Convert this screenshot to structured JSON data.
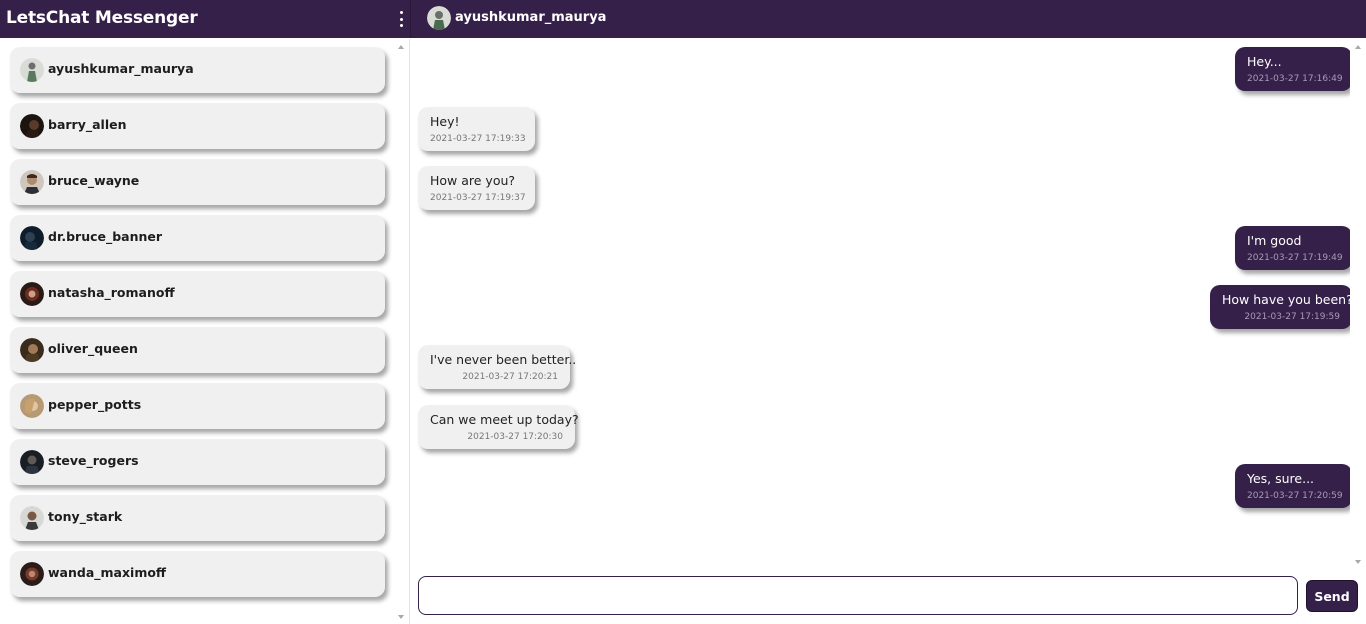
{
  "app": {
    "title": "LetsChat Messenger",
    "menu_icon": "more-vertical-icon",
    "accent_color": "#35204a"
  },
  "header": {
    "contact_name": "ayushkumar_maurya"
  },
  "contacts": [
    {
      "name": "ayushkumar_maurya"
    },
    {
      "name": "barry_allen"
    },
    {
      "name": "bruce_wayne"
    },
    {
      "name": "dr.bruce_banner"
    },
    {
      "name": "natasha_romanoff"
    },
    {
      "name": "oliver_queen"
    },
    {
      "name": "pepper_potts"
    },
    {
      "name": "steve_rogers"
    },
    {
      "name": "tony_stark"
    },
    {
      "name": "wanda_maximoff"
    }
  ],
  "messages": [
    {
      "direction": "out",
      "text": "Hey...",
      "time": "2021-03-27 17:16:49"
    },
    {
      "direction": "in",
      "text": "Hey!",
      "time": "2021-03-27 17:19:33"
    },
    {
      "direction": "in",
      "text": "How are you?",
      "time": "2021-03-27 17:19:37"
    },
    {
      "direction": "out",
      "text": "I'm good",
      "time": "2021-03-27 17:19:49"
    },
    {
      "direction": "out",
      "text": "How have you been?",
      "time": "2021-03-27 17:19:59"
    },
    {
      "direction": "in",
      "text": "I've never been better..",
      "time": "2021-03-27 17:20:21"
    },
    {
      "direction": "in",
      "text": "Can we meet up today?",
      "time": "2021-03-27 17:20:30"
    },
    {
      "direction": "out",
      "text": "Yes, sure...",
      "time": "2021-03-27 17:20:59"
    }
  ],
  "composer": {
    "value": "",
    "placeholder": "",
    "send_label": "Send"
  }
}
